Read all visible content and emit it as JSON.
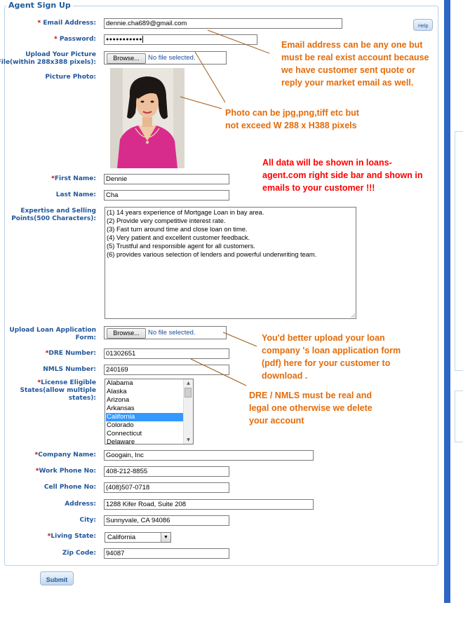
{
  "form": {
    "title": "Agent Sign Up",
    "required_mark": "*",
    "help_label": "Help",
    "submit_label": "Submit"
  },
  "fields": {
    "email": {
      "label": "Email Address:",
      "value": "dennie.cha689@gmail.com"
    },
    "password": {
      "label": "Password:",
      "value": "●●●●●●●●●●●"
    },
    "picture_upload": {
      "label_line1": "Upload Your Picture",
      "label_line2": "File(within 288x388 pixels):",
      "button": "Browse...",
      "status": "No file selected."
    },
    "picture_photo": {
      "label": "Picture Photo:"
    },
    "first_name": {
      "label": "First Name:",
      "value": "Dennie"
    },
    "last_name": {
      "label": "Last Name:",
      "value": "Cha"
    },
    "expertise": {
      "label_line1": "Expertise and Selling",
      "label_line2": "Points(500 Characters):",
      "lines": [
        "(1) 14 years experience of Mortgage Loan in bay area.",
        "(2) Provide very competitive interest rate.",
        "(3) Fast turn around time and close loan on time.",
        "(4) Very patient and excellent customer feedback.",
        "(5) Trustful and responsible agent for all customers.",
        "(6) provides various selection of lenders and powerful underwriting team."
      ]
    },
    "loan_application": {
      "label_line1": "Upload Loan Application",
      "label_line2": "Form:",
      "button": "Browse...",
      "status": "No file selected."
    },
    "dre_number": {
      "label": "DRE Number:",
      "value": "01302651"
    },
    "nmls_number": {
      "label": "NMLS Number:",
      "value": "240169"
    },
    "license_states": {
      "label_line1": "License Eligible",
      "label_line2": "States(allow multiple",
      "label_line3": "states):",
      "options": [
        "Alabama",
        "Alaska",
        "Arizona",
        "Arkansas",
        "California",
        "Colorado",
        "Connecticut",
        "Delaware"
      ],
      "selected": "California"
    },
    "company_name": {
      "label": "Company Name:",
      "value": "Googain, Inc"
    },
    "work_phone": {
      "label": "Work Phone No:",
      "value": "408-212-8855"
    },
    "cell_phone": {
      "label": "Cell Phone No:",
      "value": "(408)507-0718"
    },
    "address": {
      "label": "Address:",
      "value": "1288 Kifer Road, Suite 208"
    },
    "city": {
      "label": "City:",
      "value": "Sunnyvale, CA 94086"
    },
    "living_state": {
      "label": "Living State:",
      "value": "California"
    },
    "zip_code": {
      "label": "Zip Code:",
      "value": "94087"
    }
  },
  "annotations": {
    "email_note": "Email address can be any one but\nmust be real exist account because\nwe have customer sent quote or\nreply your market email as well.",
    "photo_note": "Photo can be jpg,png,tiff etc but\nnot exceed W 288 x H388 pixels",
    "data_note": "All data will be shown in loans-\nagent.com right side bar and shown in\nemails to your customer !!!",
    "loan_note": "You'd better upload your loan\ncompany 's loan application form\n(pdf) here for your customer to\ndownload .",
    "dre_note": "DRE / NMLS must be real and\nlegal one otherwise we delete\nyour account"
  },
  "colors": {
    "label_blue": "#21569a",
    "required_red": "#c00000",
    "note_orange": "#e36c0a",
    "note_red": "#ff0000",
    "select_highlight": "#3399ff",
    "frame_border": "#b8cfe3",
    "sidebar_blue": "#2e66c4"
  }
}
